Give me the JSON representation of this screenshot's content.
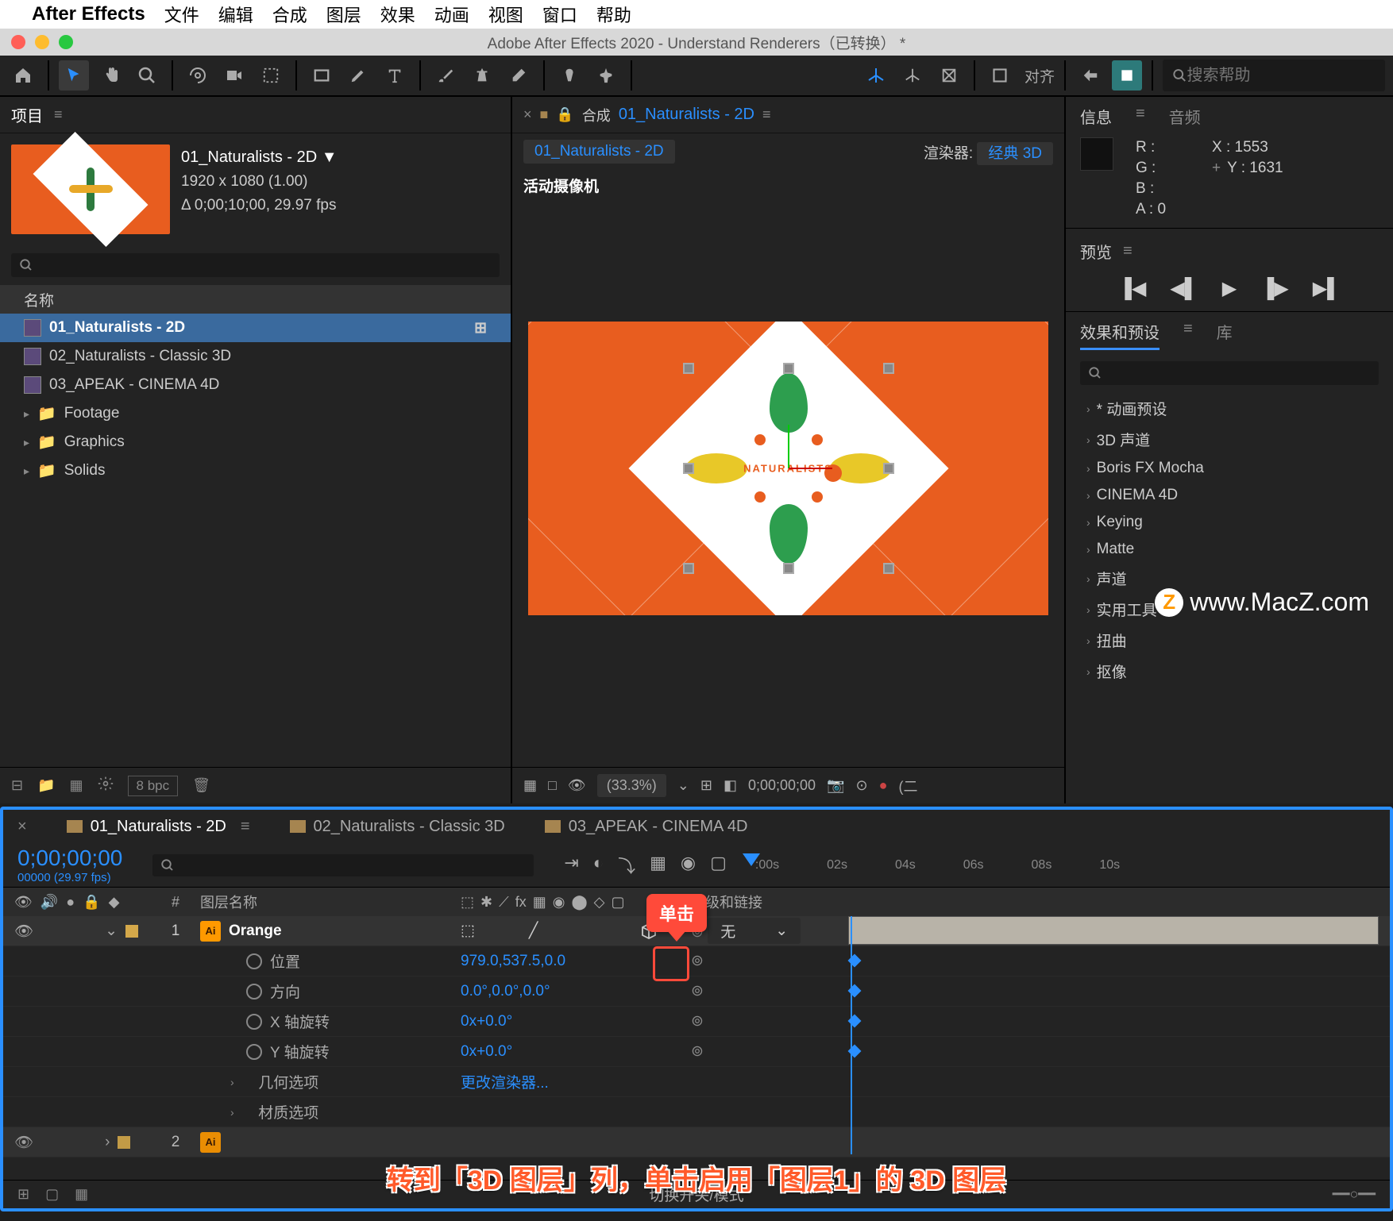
{
  "menubar": {
    "app": "After Effects",
    "items": [
      "文件",
      "编辑",
      "合成",
      "图层",
      "效果",
      "动画",
      "视图",
      "窗口",
      "帮助"
    ]
  },
  "window": {
    "title": "Adobe After Effects 2020 - Understand Renderers（已转换） *"
  },
  "toolbar": {
    "align_label": "对齐",
    "search_placeholder": "搜索帮助"
  },
  "project": {
    "tab": "项目",
    "title": "01_Naturalists - 2D ▼",
    "dims": "1920 x 1080 (1.00)",
    "duration": "Δ 0;00;10;00, 29.97 fps",
    "name_header": "名称",
    "items": [
      {
        "name": "01_Naturalists - 2D",
        "type": "comp",
        "selected": true
      },
      {
        "name": "02_Naturalists - Classic 3D",
        "type": "comp"
      },
      {
        "name": "03_APEAK - CINEMA 4D",
        "type": "comp"
      },
      {
        "name": "Footage",
        "type": "folder"
      },
      {
        "name": "Graphics",
        "type": "folder"
      },
      {
        "name": "Solids",
        "type": "folder"
      }
    ],
    "bpc": "8 bpc"
  },
  "composition": {
    "panel_label": "合成",
    "title": "01_Naturalists - 2D",
    "breadcrumb": "01_Naturalists - 2D",
    "renderer_label": "渲染器:",
    "renderer_value": "经典 3D",
    "camera": "活动摄像机",
    "center_text": "NATURALISTS",
    "zoom": "(33.3%)",
    "timecode": "0;00;00;00",
    "footer_suffix": "(二"
  },
  "info": {
    "tab_info": "信息",
    "tab_audio": "音频",
    "r": "R :",
    "g": "G :",
    "b": "B :",
    "a": "A :  0",
    "x": "X : 1553",
    "y": "Y : 1631"
  },
  "preview": {
    "tab": "预览"
  },
  "effects": {
    "tab_effects": "效果和预设",
    "tab_lib": "库",
    "items": [
      "* 动画预设",
      "3D 声道",
      "Boris FX Mocha",
      "CINEMA 4D",
      "Keying",
      "Matte",
      "声道",
      "实用工具",
      "扭曲",
      "抠像"
    ]
  },
  "watermark": "www.MacZ.com",
  "timeline": {
    "tabs": [
      {
        "label": "01_Naturalists - 2D",
        "active": true
      },
      {
        "label": "02_Naturalists - Classic 3D"
      },
      {
        "label": "03_APEAK - CINEMA 4D"
      }
    ],
    "timecode": "0;00;00;00",
    "timecode_sub": "00000 (29.97 fps)",
    "ruler": [
      ":00s",
      "02s",
      "04s",
      "06s",
      "08s",
      "10s"
    ],
    "col_num": "#",
    "col_name": "图层名称",
    "col_parent": "父级和链接",
    "layer1": {
      "num": "1",
      "name": "Orange",
      "parent": "无",
      "props": [
        {
          "label": "位置",
          "value": "979.0,537.5,0.0"
        },
        {
          "label": "方向",
          "value": "0.0°,0.0°,0.0°"
        },
        {
          "label": "X 轴旋转",
          "value": "0x+0.0°"
        },
        {
          "label": "Y 轴旋转",
          "value": "0x+0.0°"
        }
      ],
      "sub": [
        {
          "label": "几何选项",
          "value": "更改渲染器..."
        },
        {
          "label": "材质选项",
          "value": ""
        }
      ]
    },
    "layer2_num": "2",
    "footer_center": "切换开关/模式"
  },
  "callout": {
    "label": "单击"
  },
  "instruction": {
    "text_pre": "转到「",
    "text_col": "3D 图层",
    "text_mid": "」列，单击启用「",
    "text_layer": "图层1",
    "text_suf": "」的 3D 图层"
  }
}
